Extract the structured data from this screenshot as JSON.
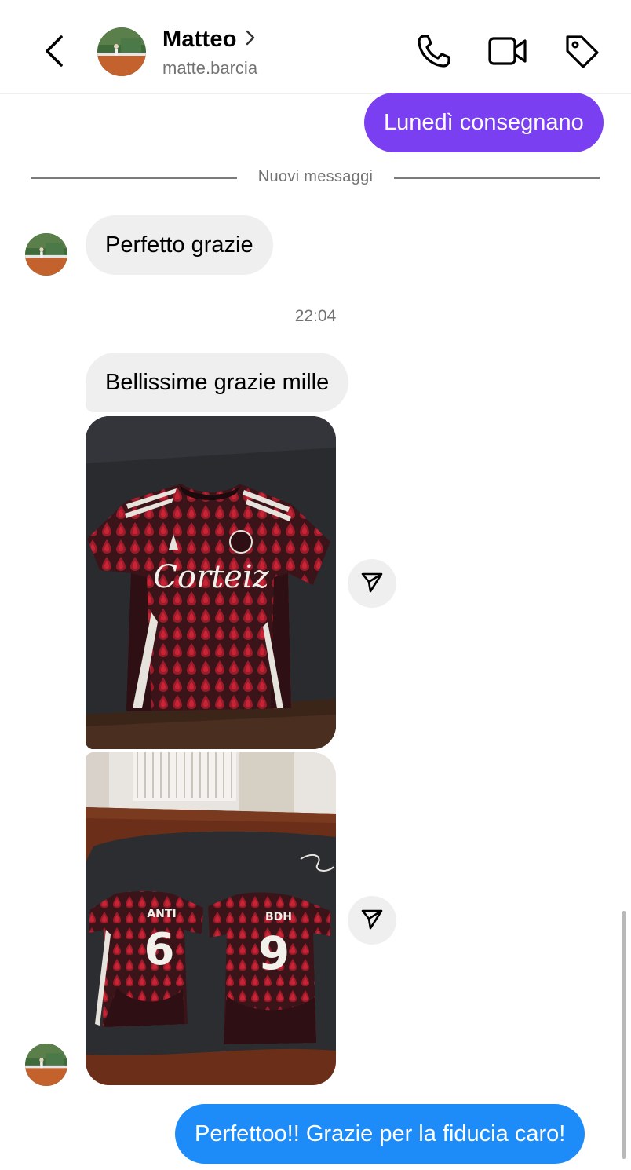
{
  "header": {
    "name": "Matteo",
    "username": "matte.barcia"
  },
  "messages": {
    "outgoing_1": "Lunedì consegnano",
    "divider_label": "Nuovi messaggi",
    "incoming_1": "Perfetto grazie",
    "timestamp": "22:04",
    "incoming_2": "Bellissime grazie mille",
    "photo_1": {
      "jersey_text": "Corteiz"
    },
    "photo_2": {
      "left_name": "ANTI",
      "left_number": "6",
      "right_name": "BDH",
      "right_number": "9"
    },
    "outgoing_2": "Perfettoo!! Grazie per la fiducia caro!"
  },
  "icons": {
    "back": "chevron-left-icon",
    "profile_chevron": "chevron-right-icon",
    "call": "phone-icon",
    "video": "video-camera-icon",
    "tag": "tag-icon",
    "share": "paper-plane-icon"
  },
  "colors": {
    "outgoing_purple": "#7b3ff2",
    "outgoing_blue": "#1d8cf8",
    "incoming_bg": "#efefef",
    "secondary_text": "#737373"
  }
}
